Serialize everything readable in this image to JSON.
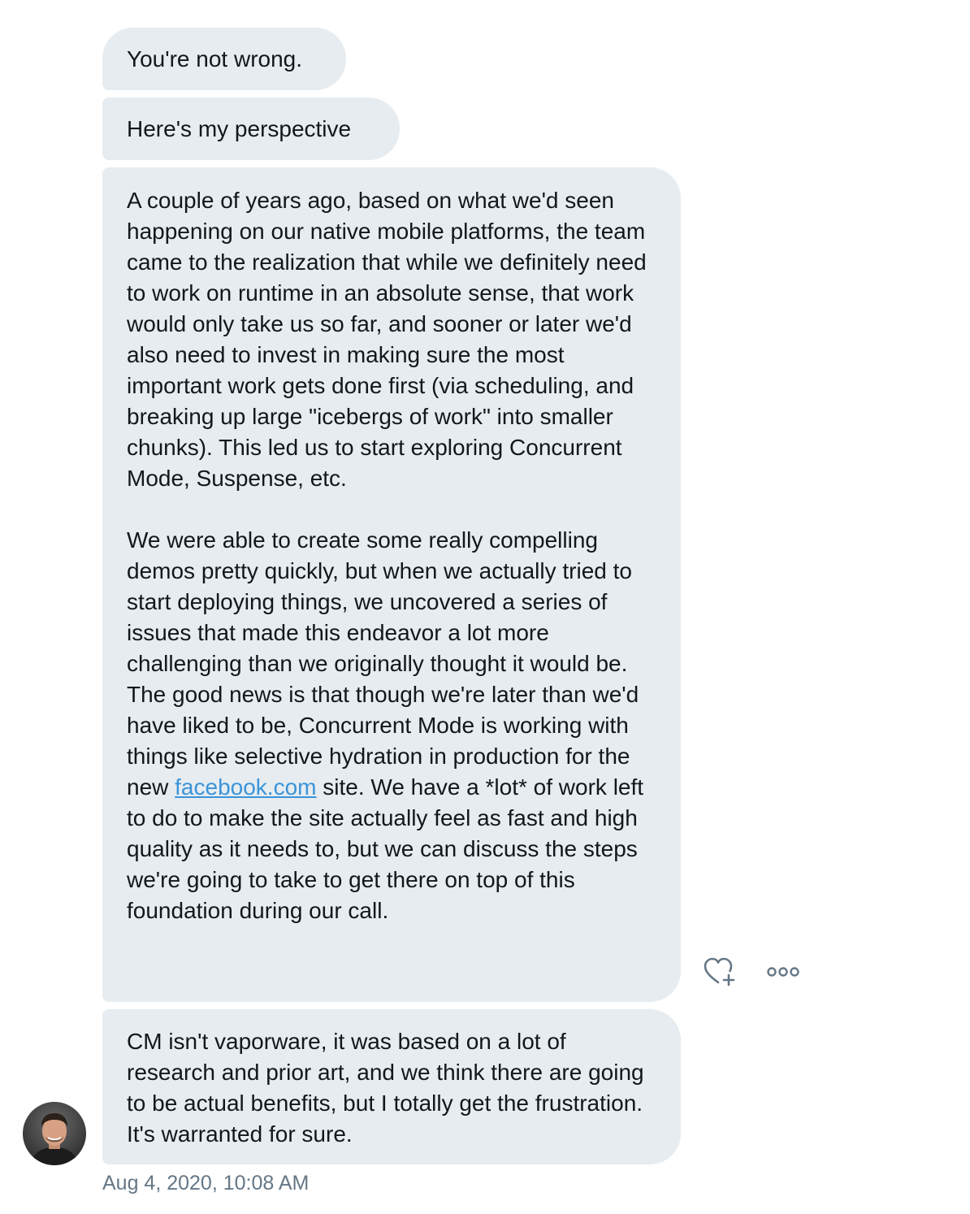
{
  "messages": [
    {
      "text": "You're not wrong."
    },
    {
      "text": "Here's my perspective"
    },
    {
      "paragraph1": "A couple of years ago, based on what we'd seen happening on our native mobile platforms, the team came to the realization that while we definitely need to work on runtime in an absolute sense, that work would only take us so far, and sooner or later we'd also need to invest in making sure the most important work gets done first (via scheduling, and breaking up large \"icebergs of work\" into smaller chunks). This led us to start exploring Concurrent Mode, Suspense, etc.",
      "paragraph2_before_link": "We were able to create some really compelling demos pretty quickly, but when we actually tried to start deploying things, we uncovered a series of issues that made this endeavor a lot more challenging than we originally thought it would be. The good news is that though we're later than we'd have liked to be, Concurrent Mode is working with things like selective hydration in production for the new ",
      "link_text": "facebook.com",
      "paragraph2_after_link": " site. We have a *lot* of work left to do to make the site actually feel as fast and high quality as it needs to, but we can discuss the steps we're going to take to get there on top of this foundation during our call."
    },
    {
      "text": "CM isn't vaporware, it was based on a lot of research and prior art, and we think there are going to be actual benefits, but I totally get the frustration. It's warranted for sure."
    }
  ],
  "timestamp": "Aug 4, 2020, 10:08 AM",
  "actions": {
    "like_icon": "heart-plus-icon",
    "more_icon": "more-icon"
  },
  "colors": {
    "bubble": "#e6ecf0",
    "link": "#3b94d9",
    "icon": "#657786",
    "timestamp": "#657786"
  }
}
